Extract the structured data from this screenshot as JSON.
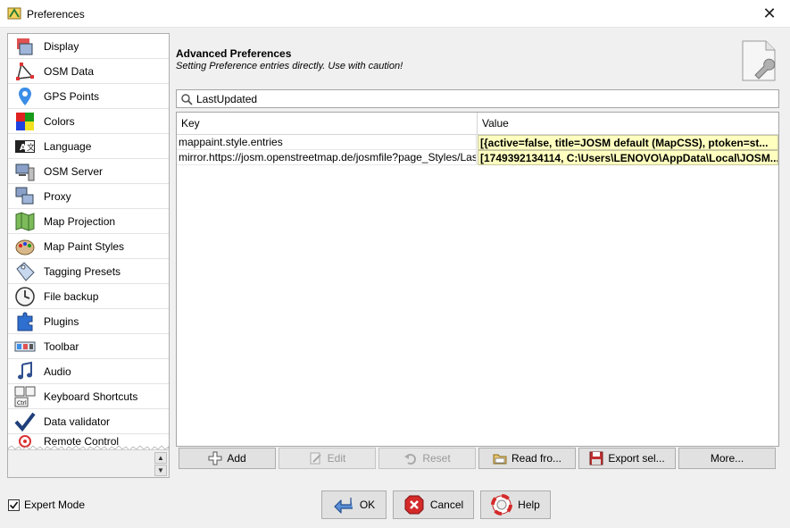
{
  "window": {
    "title": "Preferences",
    "app_icon": "josm-icon",
    "close_icon": "close-icon"
  },
  "sidebar": {
    "items": [
      {
        "label": "Display",
        "icon": "display-icon"
      },
      {
        "label": "OSM Data",
        "icon": "osm-data-icon"
      },
      {
        "label": "GPS Points",
        "icon": "gps-points-icon"
      },
      {
        "label": "Colors",
        "icon": "colors-icon"
      },
      {
        "label": "Language",
        "icon": "language-icon"
      },
      {
        "label": "OSM Server",
        "icon": "osm-server-icon"
      },
      {
        "label": "Proxy",
        "icon": "proxy-icon"
      },
      {
        "label": "Map Projection",
        "icon": "map-projection-icon"
      },
      {
        "label": "Map Paint Styles",
        "icon": "map-paint-styles-icon"
      },
      {
        "label": "Tagging Presets",
        "icon": "tagging-presets-icon"
      },
      {
        "label": "File backup",
        "icon": "file-backup-icon"
      },
      {
        "label": "Plugins",
        "icon": "plugins-icon"
      },
      {
        "label": "Toolbar",
        "icon": "toolbar-icon"
      },
      {
        "label": "Audio",
        "icon": "audio-icon"
      },
      {
        "label": "Keyboard Shortcuts",
        "icon": "keyboard-shortcuts-icon"
      },
      {
        "label": "Data validator",
        "icon": "data-validator-icon"
      },
      {
        "label": "Remote Control",
        "icon": "remote-control-icon"
      }
    ]
  },
  "panel": {
    "title": "Advanced Preferences",
    "subtitle": "Setting Preference entries directly. Use with caution!",
    "icon": "preferences-document-icon"
  },
  "search": {
    "value": "LastUpdated",
    "icon": "search-icon"
  },
  "table": {
    "columns": [
      "Key",
      "Value"
    ],
    "rows": [
      {
        "key": "mappaint.style.entries",
        "value": "[{active=false, title=JOSM default (MapCSS), ptoken=st..."
      },
      {
        "key": "mirror.https://josm.openstreetmap.de/josmfile?page_Styles/LastU...",
        "value": "[1749392134114, C:\\Users\\LENOVO\\AppData\\Local\\JOSM..."
      }
    ]
  },
  "actions": {
    "add": "Add",
    "edit": "Edit",
    "reset": "Reset",
    "read_from": "Read fro...",
    "export_selected": "Export sel...",
    "more": "More..."
  },
  "footer": {
    "expert_mode": "Expert Mode",
    "expert_mode_checked": true,
    "ok": "OK",
    "cancel": "Cancel",
    "help": "Help"
  }
}
